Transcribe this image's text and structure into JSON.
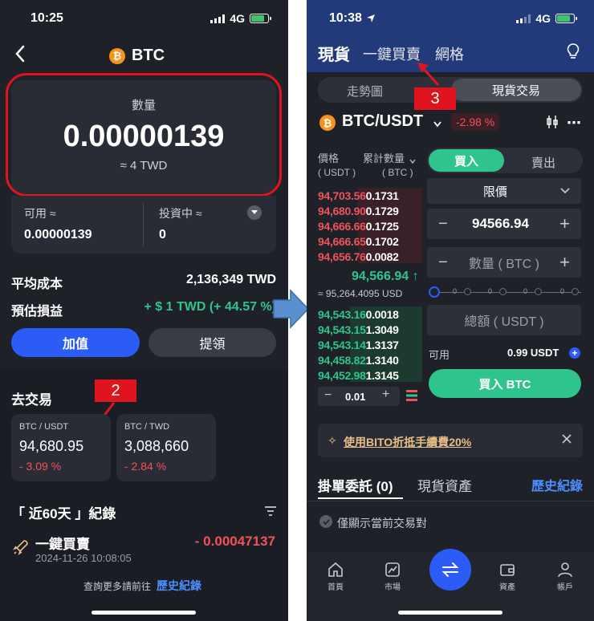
{
  "left": {
    "status": {
      "time": "10:25",
      "network": "4G"
    },
    "header": {
      "coin_symbol": "₿",
      "title": "BTC"
    },
    "balance": {
      "label": "數量",
      "amount": "0.00000139",
      "fiat": "≈ 4 TWD"
    },
    "available": {
      "label": "可用 ≈",
      "value": "0.00000139"
    },
    "investing": {
      "label": "投資中 ≈",
      "value": "0"
    },
    "avg_cost": {
      "label": "平均成本",
      "value": "2,136,349 TWD"
    },
    "est_pnl": {
      "label": "預估損益",
      "value": "+ $ 1 TWD (+ 44.57 %)"
    },
    "buttons": {
      "deposit": "加值",
      "withdraw": "提領"
    },
    "go_trade": {
      "title": "去交易",
      "step_badge": "2"
    },
    "pairs": [
      {
        "name": "BTC / USDT",
        "price": "94,680.95",
        "change": "- 3.09 %"
      },
      {
        "name": "BTC / TWD",
        "price": "3,088,660",
        "change": "- 2.84 %"
      }
    ],
    "records": {
      "title": "「 近60天 」紀錄",
      "item_title": "一鍵買賣",
      "item_time": "2024-11-26 10:08:05",
      "item_amount": "- 0.00047137"
    },
    "footer": {
      "prefix": "查詢更多請前往",
      "link": "歷史紀錄"
    }
  },
  "right": {
    "status": {
      "time": "10:38",
      "network": "4G"
    },
    "top_tabs": [
      "現貨",
      "一鍵買賣",
      "網格"
    ],
    "step_badge": "3",
    "segments": [
      "走勢圖",
      "現貨交易"
    ],
    "pair": {
      "name": "BTC/USDT",
      "change": "-2.98 %"
    },
    "orderbook": {
      "price_header": "價格",
      "price_unit": "( USDT )",
      "amount_header": "累計數量",
      "amount_unit": "( BTC )",
      "asks": [
        {
          "price": "94,703.56",
          "amount": "0.1731"
        },
        {
          "price": "94,680.90",
          "amount": "0.1729"
        },
        {
          "price": "94,666.66",
          "amount": "0.1725"
        },
        {
          "price": "94,666.65",
          "amount": "0.1702"
        },
        {
          "price": "94,656.76",
          "amount": "0.0082"
        }
      ],
      "mid_price": "94,566.94",
      "mid_arrow": "↑",
      "mid_usd": "≈ 95,264.4095 USD",
      "bids": [
        {
          "price": "94,543.16",
          "amount": "0.0018"
        },
        {
          "price": "94,543.15",
          "amount": "1.3049"
        },
        {
          "price": "94,543.14",
          "amount": "1.3137"
        },
        {
          "price": "94,458.82",
          "amount": "1.3140"
        },
        {
          "price": "94,452.98",
          "amount": "1.3145"
        }
      ],
      "step": "0.01"
    },
    "order_form": {
      "buy_tab": "買入",
      "sell_tab": "賣出",
      "order_type": "限價",
      "price": "94566.94",
      "qty_placeholder": "數量 ( BTC )",
      "total_placeholder": "總額 ( USDT )",
      "available_label": "可用",
      "available_value": "0.99 USDT",
      "submit": "買入 BTC"
    },
    "slider": {
      "ticks": [
        "0",
        "0",
        "0",
        "0"
      ]
    },
    "promo": {
      "text": "使用BITO折抵手續費20%"
    },
    "bottom_tabs": {
      "open_orders": "掛單委託 (0)",
      "assets": "現貨資產",
      "history": "歷史紀錄"
    },
    "only_current": "僅顯示當前交易對",
    "tabbar": [
      "首頁",
      "市場",
      "",
      "資產",
      "帳戶"
    ]
  },
  "colors": {
    "bg": "#1f2129",
    "card": "#2a2c35",
    "accent_blue": "#2b5cf5",
    "green": "#2ec48c",
    "red": "#f0525a",
    "highlight": "#e0141e"
  }
}
